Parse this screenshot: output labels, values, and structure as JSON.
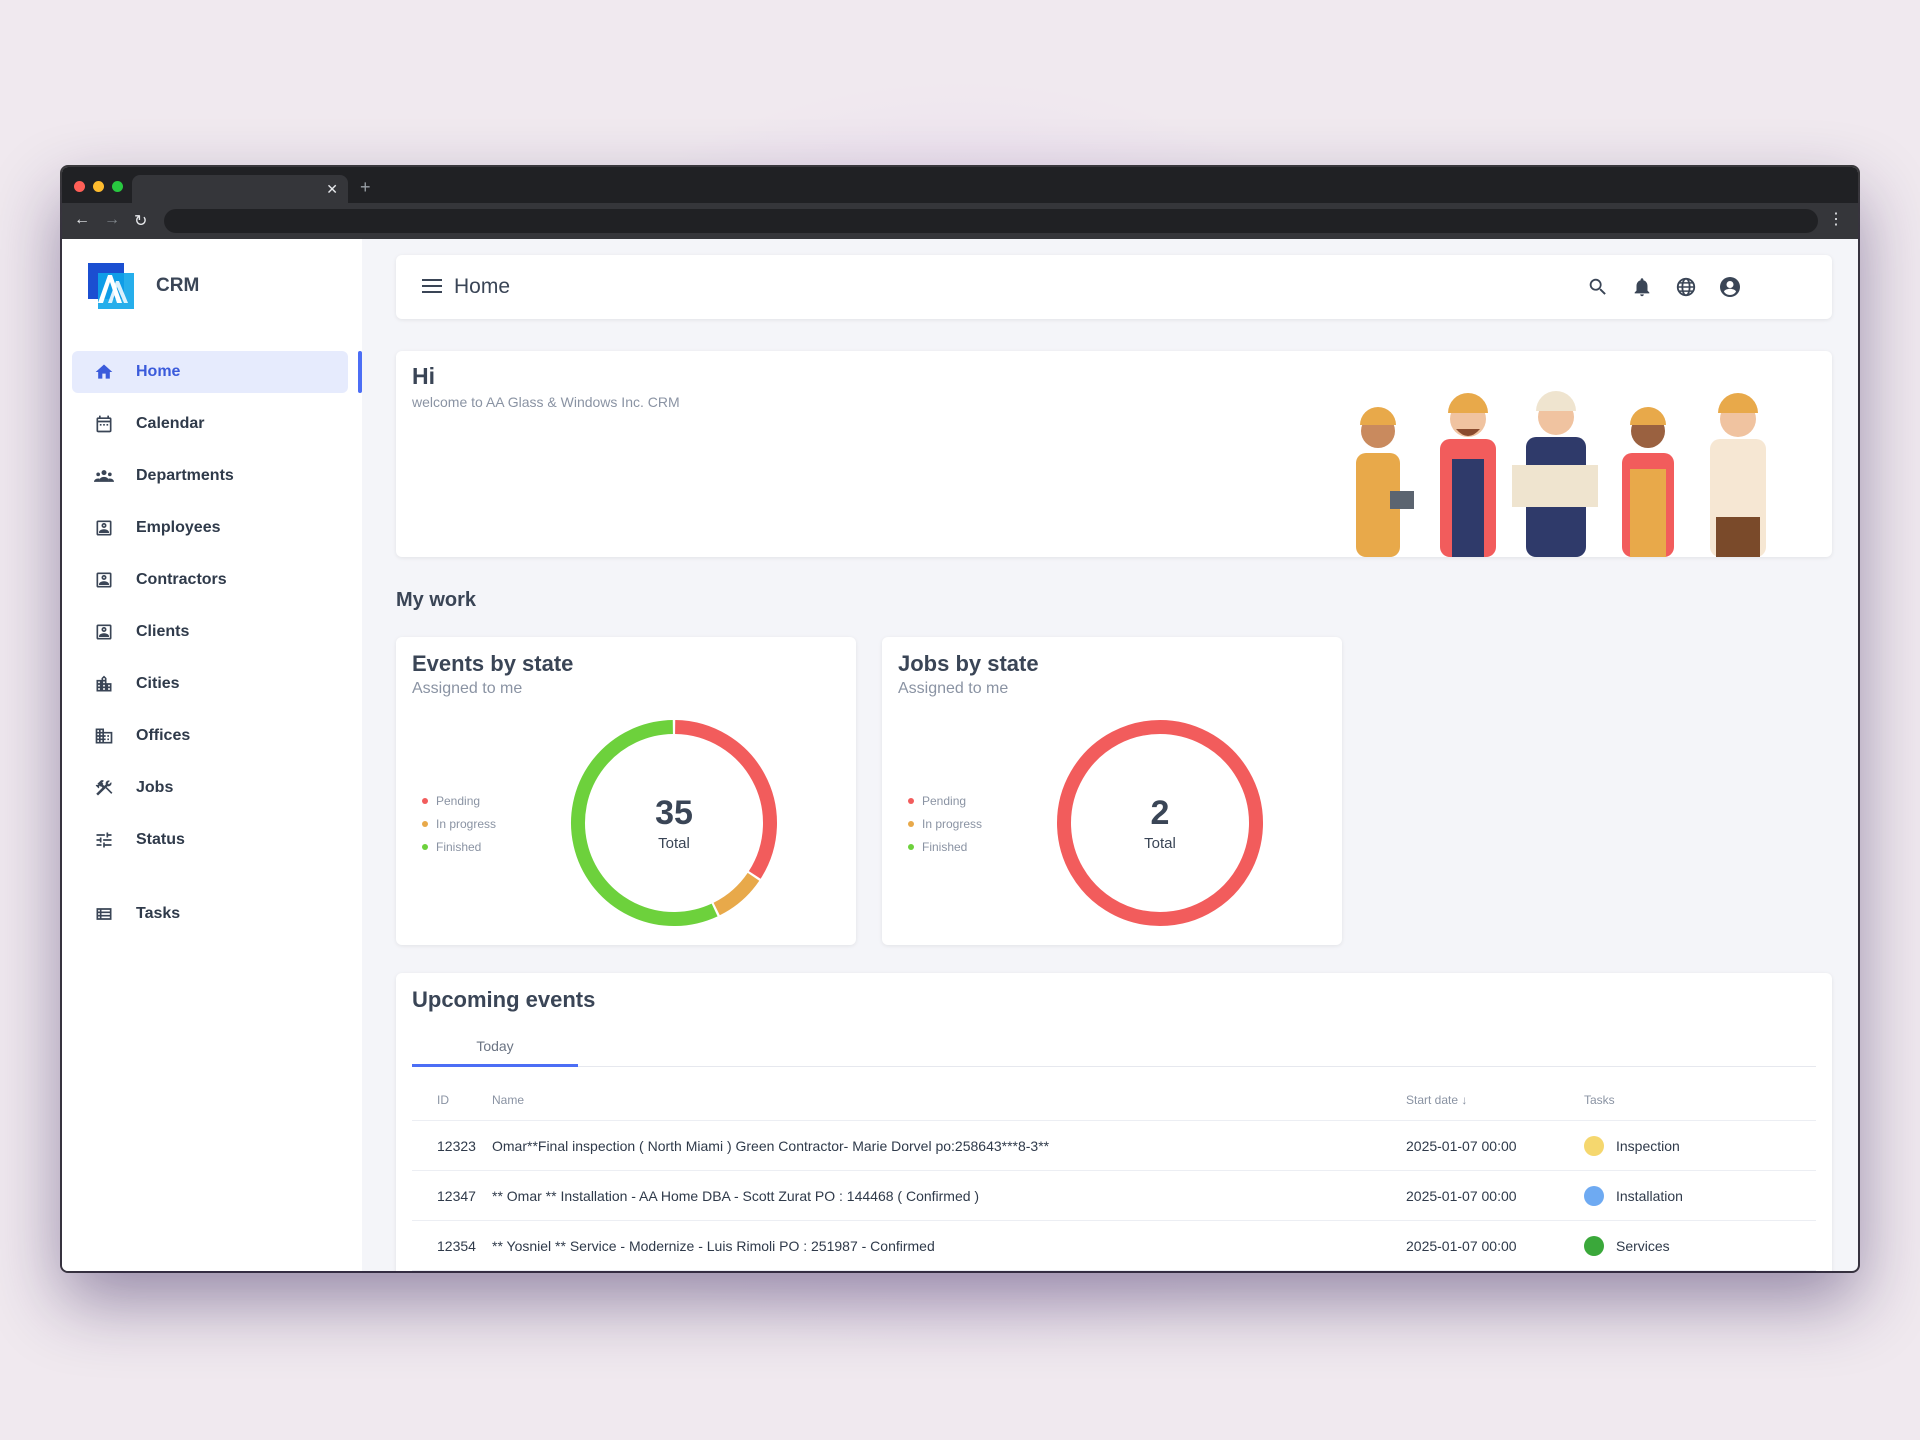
{
  "app": {
    "name": "CRM"
  },
  "header": {
    "title": "Home"
  },
  "sidebar": {
    "items": [
      {
        "label": "Home",
        "icon": "home-icon"
      },
      {
        "label": "Calendar",
        "icon": "calendar-icon"
      },
      {
        "label": "Departments",
        "icon": "groups-icon"
      },
      {
        "label": "Employees",
        "icon": "contact-icon"
      },
      {
        "label": "Contractors",
        "icon": "contact-icon"
      },
      {
        "label": "Clients",
        "icon": "contact-icon"
      },
      {
        "label": "Cities",
        "icon": "city-icon"
      },
      {
        "label": "Offices",
        "icon": "office-icon"
      },
      {
        "label": "Jobs",
        "icon": "tools-icon"
      },
      {
        "label": "Status",
        "icon": "tune-icon"
      },
      {
        "label": "Tasks",
        "icon": "list-icon"
      }
    ]
  },
  "hero": {
    "title": "Hi",
    "subtitle": "welcome to AA Glass & Windows Inc. CRM"
  },
  "my_work": {
    "title": "My work"
  },
  "events_by_state": {
    "title": "Events by state",
    "subtitle": "Assigned to me",
    "legend": [
      "Pending",
      "In progress",
      "Finished"
    ],
    "total": "35",
    "total_label": "Total"
  },
  "jobs_by_state": {
    "title": "Jobs by state",
    "subtitle": "Assigned to me",
    "legend": [
      "Pending",
      "In progress",
      "Finished"
    ],
    "total": "2",
    "total_label": "Total"
  },
  "chart_data": [
    {
      "type": "pie",
      "title": "Events by state",
      "categories": [
        "Pending",
        "In progress",
        "Finished"
      ],
      "values": [
        12,
        3,
        20
      ],
      "colors": [
        "#f25c5c",
        "#e8a94a",
        "#6dd13c"
      ]
    },
    {
      "type": "pie",
      "title": "Jobs by state",
      "categories": [
        "Pending",
        "In progress",
        "Finished"
      ],
      "values": [
        2,
        0,
        0
      ],
      "colors": [
        "#f25c5c",
        "#e8a94a",
        "#6dd13c"
      ]
    }
  ],
  "upcoming": {
    "title": "Upcoming events",
    "tab": "Today",
    "columns": {
      "id": "ID",
      "name": "Name",
      "start": "Start date",
      "tasks": "Tasks"
    },
    "rows": [
      {
        "id": "12323",
        "name": "Omar**Final inspection ( North Miami ) Green Contractor- Marie Dorvel po:258643***8-3**",
        "start": "2025-01-07 00:00",
        "task": "Inspection",
        "color": "#f5d76e"
      },
      {
        "id": "12347",
        "name": "** Omar ** Installation - AA Home DBA - Scott Zurat PO : 144468 ( Confirmed )",
        "start": "2025-01-07 00:00",
        "task": "Installation",
        "color": "#6eaaf2"
      },
      {
        "id": "12354",
        "name": "** Yosniel ** Service - Modernize - Luis Rimoli PO : 251987 - Confirmed",
        "start": "2025-01-07 00:00",
        "task": "Services",
        "color": "#3aa83a"
      }
    ]
  }
}
